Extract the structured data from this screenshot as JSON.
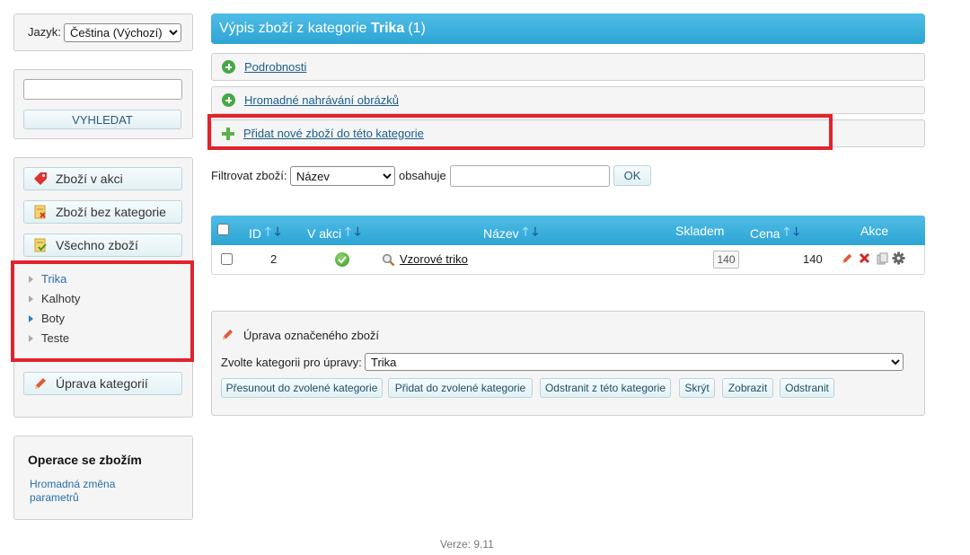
{
  "language": {
    "label": "Jazyk:",
    "selected": "Čeština (Výchozí)"
  },
  "search": {
    "placeholder": "",
    "button": "VYHLEDAT"
  },
  "sidebar": {
    "buttons": [
      {
        "label": "Zboží v akci",
        "icon": "tag-icon"
      },
      {
        "label": "Zboží bez kategorie",
        "icon": "note-x-icon"
      },
      {
        "label": "Všechno zboží",
        "icon": "note-check-icon"
      }
    ],
    "categories": [
      "Trika",
      "Kalhoty",
      "Boty",
      "Teste"
    ],
    "edit_categories": "Úprava kategorií"
  },
  "operations": {
    "title": "Operace se zbožím",
    "link": "Hromadná změna parametrů"
  },
  "header": {
    "prefix": "Výpis zboží z kategorie ",
    "category": "Trika",
    "count": "(1)"
  },
  "accordion": {
    "details": "Podrobnosti",
    "bulk_upload": "Hromadné nahrávání obrázků",
    "add_product": "Přidat nové zboží do této kategorie"
  },
  "filter": {
    "label": "Filtrovat zboží:",
    "field": "Název",
    "contains": "obsahuje",
    "value": "",
    "ok": "OK"
  },
  "table": {
    "columns": {
      "id": "ID",
      "sale": "V akci",
      "name": "Název",
      "stock": "Skladem",
      "price": "Cena",
      "actions": "Akce"
    },
    "rows": [
      {
        "id": "2",
        "sale": true,
        "name": "Vzorové triko",
        "stock": "140",
        "price": "140"
      }
    ]
  },
  "bulk_edit": {
    "title": "Úprava označeného zboží",
    "category_label": "Zvolte kategorii pro úpravy:",
    "category_selected": "Trika",
    "buttons": [
      "Přesunout do zvolené kategorie",
      "Přidat do zvolené kategorie",
      "Odstranit z této kategorie",
      "Skrýt",
      "Zobrazit",
      "Odstranit"
    ]
  },
  "version": "Verze: 9.11",
  "colors": {
    "header_blue": "#3fb0dc",
    "link": "#1b5e8c",
    "highlight_red": "#e1232b",
    "accent_green": "#47a846"
  }
}
